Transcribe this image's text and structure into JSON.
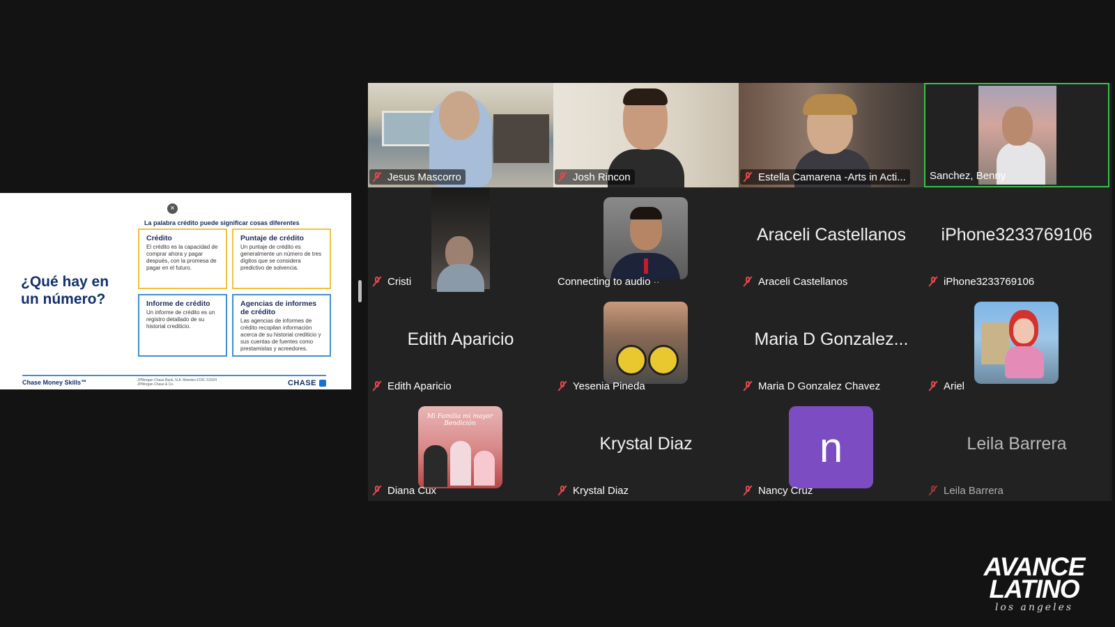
{
  "slide": {
    "subtitle": "La palabra crédito puede significar cosas diferentes",
    "title": "¿Qué hay en un número?",
    "close_symbol": "×",
    "boxes": [
      {
        "heading": "Crédito",
        "body": "El crédito es la capacidad de comprar ahora y pagar después, con la promesa de pagar en el futuro."
      },
      {
        "heading": "Puntaje de crédito",
        "body": "Un puntaje de crédito es generalmente un número de tres dígitos que se considera predictivo de solvencia."
      },
      {
        "heading": "Informe de crédito",
        "body": "Un informe de crédito es un registro detallado de su historial crediticio."
      },
      {
        "heading": "Agencias de informes de crédito",
        "body": "Las agencias de informes de crédito recopilan información acerca de su historial crediticio y sus cuentas de fuentes como prestamistas y acreedores."
      }
    ],
    "footer_brand": "Chase Money Skills℠",
    "footer_legal": "JPMorgan Chase Bank, N.A. Miembro FDIC ©2024 JPMorgan Chase & Co.",
    "footer_logo": "CHASE"
  },
  "participants": [
    {
      "name": "Jesus Mascorro",
      "muted": true,
      "kind": "video"
    },
    {
      "name": "Josh Rincon",
      "muted": true,
      "kind": "video"
    },
    {
      "name": "Estella Camarena -Arts in Acti...",
      "muted": true,
      "kind": "video"
    },
    {
      "name": "Sanchez, Benny",
      "muted": false,
      "kind": "video",
      "active_speaker": true
    },
    {
      "name": "Cristi",
      "muted": true,
      "kind": "video"
    },
    {
      "name": "Connecting to audio",
      "muted": false,
      "kind": "photo"
    },
    {
      "name": "Araceli Castellanos",
      "big_name": "Araceli Castellanos",
      "muted": true,
      "kind": "name"
    },
    {
      "name": "iPhone3233769106",
      "big_name": "iPhone3233769106",
      "muted": true,
      "kind": "name"
    },
    {
      "name": "Edith Aparicio",
      "big_name": "Edith Aparicio",
      "muted": true,
      "kind": "name"
    },
    {
      "name": "Yesenia Pineda",
      "muted": true,
      "kind": "photo"
    },
    {
      "name": "Maria D Gonzalez Chavez",
      "big_name": "Maria D Gonzalez...",
      "muted": true,
      "kind": "name"
    },
    {
      "name": "Ariel",
      "muted": true,
      "kind": "photo"
    },
    {
      "name": "Diana Cux",
      "muted": true,
      "kind": "photo",
      "photo_caption": "Mi Familia mi mayor Bendición"
    },
    {
      "name": "Krystal Diaz",
      "big_name": "Krystal Diaz",
      "muted": true,
      "kind": "name"
    },
    {
      "name": "Nancy Cruz",
      "avatar_letter": "n",
      "muted": true,
      "kind": "letter"
    },
    {
      "name": "Leila Barrera",
      "big_name": "Leila Barrera",
      "muted": true,
      "kind": "name",
      "dimmed": true
    }
  ],
  "connecting_dots": "··",
  "brand": {
    "line1": "AVANCE",
    "line2": "LATINO",
    "line3": "los angeles"
  },
  "colors": {
    "active_border": "#36c447",
    "mute_red": "#e5484d",
    "nancy_avatar": "#7b4cc2"
  }
}
